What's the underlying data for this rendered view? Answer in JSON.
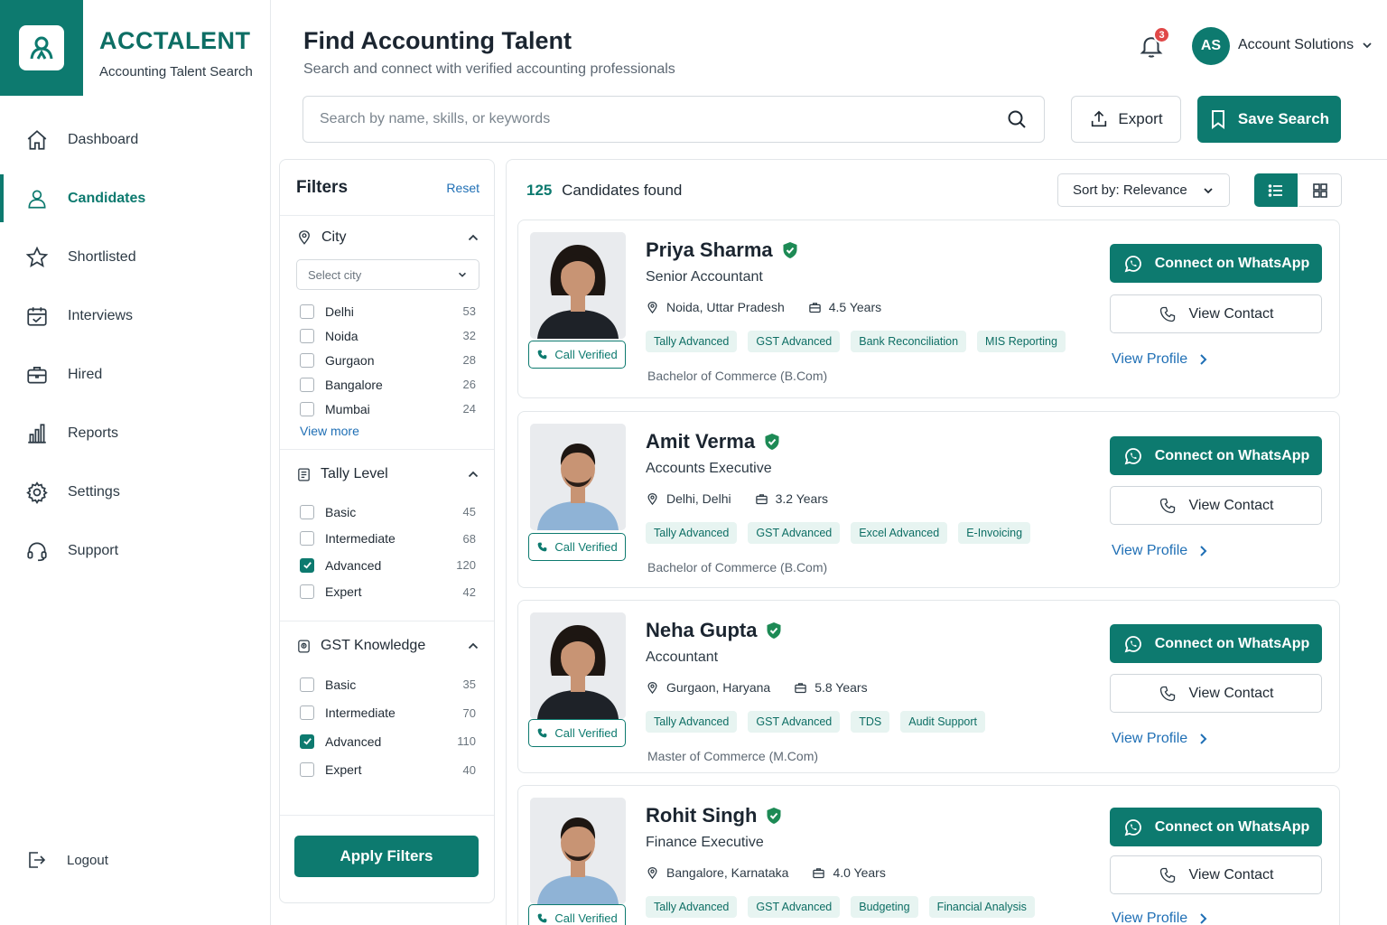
{
  "brand": {
    "title": "ACCTALENT",
    "subtitle": "Accounting Talent Search"
  },
  "sidebar": {
    "items": [
      {
        "label": "Dashboard",
        "icon": "home-icon"
      },
      {
        "label": "Candidates",
        "icon": "user-icon",
        "active": true
      },
      {
        "label": "Shortlisted",
        "icon": "star-icon"
      },
      {
        "label": "Interviews",
        "icon": "calendar-icon"
      },
      {
        "label": "Hired",
        "icon": "briefcase-icon"
      },
      {
        "label": "Reports",
        "icon": "bar-chart-icon"
      },
      {
        "label": "Settings",
        "icon": "gear-icon"
      },
      {
        "label": "Support",
        "icon": "headset-icon"
      }
    ],
    "logout": "Logout"
  },
  "header": {
    "title": "Find Accounting Talent",
    "subtitle": "Search and connect with verified accounting professionals",
    "notifications": "3",
    "avatar": "AS",
    "account": "Account Solutions"
  },
  "search": {
    "placeholder": "Search by name, skills, or keywords"
  },
  "actions": {
    "export": "Export",
    "save_search": "Save Search"
  },
  "filters": {
    "title": "Filters",
    "reset": "Reset",
    "city": {
      "title": "City",
      "select_placeholder": "Select city",
      "options": [
        {
          "label": "Delhi",
          "count": "53",
          "checked": false
        },
        {
          "label": "Noida",
          "count": "32",
          "checked": false
        },
        {
          "label": "Gurgaon",
          "count": "28",
          "checked": false
        },
        {
          "label": "Bangalore",
          "count": "26",
          "checked": false
        },
        {
          "label": "Mumbai",
          "count": "24",
          "checked": false
        }
      ],
      "view_more": "View more"
    },
    "tally": {
      "title": "Tally Level",
      "options": [
        {
          "label": "Basic",
          "count": "45",
          "checked": false
        },
        {
          "label": "Intermediate",
          "count": "68",
          "checked": false
        },
        {
          "label": "Advanced",
          "count": "120",
          "checked": true
        },
        {
          "label": "Expert",
          "count": "42",
          "checked": false
        }
      ]
    },
    "gst": {
      "title": "GST Knowledge",
      "options": [
        {
          "label": "Basic",
          "count": "35",
          "checked": false
        },
        {
          "label": "Intermediate",
          "count": "70",
          "checked": false
        },
        {
          "label": "Advanced",
          "count": "110",
          "checked": true
        },
        {
          "label": "Expert",
          "count": "40",
          "checked": false
        }
      ]
    },
    "apply": "Apply Filters"
  },
  "results": {
    "count": "125",
    "count_label": "Candidates found",
    "sort": "Sort by: Relevance",
    "call_verified": "Call Verified",
    "whatsapp": "Connect on WhatsApp",
    "view_contact": "View Contact",
    "view_profile": "View Profile",
    "candidates": [
      {
        "name": "Priya Sharma",
        "role": "Senior Accountant",
        "location": "Noida, Uttar Pradesh",
        "experience": "4.5 Years",
        "tags": [
          "Tally Advanced",
          "GST Advanced",
          "Bank Reconciliation",
          "MIS Reporting"
        ],
        "education": "Bachelor of Commerce (B.Com)",
        "gender": "f"
      },
      {
        "name": "Amit Verma",
        "role": "Accounts Executive",
        "location": "Delhi, Delhi",
        "experience": "3.2 Years",
        "tags": [
          "Tally Advanced",
          "GST Advanced",
          "Excel Advanced",
          "E-Invoicing"
        ],
        "education": "Bachelor of Commerce (B.Com)",
        "gender": "m"
      },
      {
        "name": "Neha Gupta",
        "role": "Accountant",
        "location": "Gurgaon, Haryana",
        "experience": "5.8 Years",
        "tags": [
          "Tally Advanced",
          "GST Advanced",
          "TDS",
          "Audit Support"
        ],
        "education": "Master of Commerce (M.Com)",
        "gender": "f"
      },
      {
        "name": "Rohit Singh",
        "role": "Finance Executive",
        "location": "Bangalore, Karnataka",
        "experience": "4.0 Years",
        "tags": [
          "Tally Advanced",
          "GST Advanced",
          "Budgeting",
          "Financial Analysis"
        ],
        "education": "",
        "gender": "m"
      }
    ]
  },
  "colors": {
    "primary": "#0d7a6f",
    "link": "#1f6fb5",
    "badge": "#e04848",
    "tag_bg": "#e7f4f1"
  }
}
